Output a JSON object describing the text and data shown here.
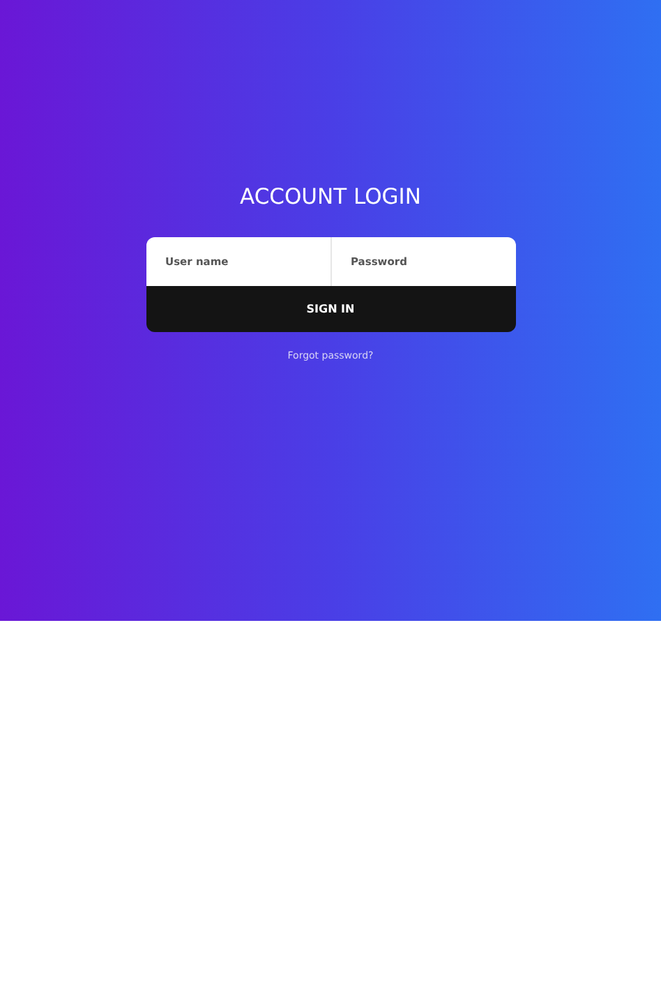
{
  "title": "ACCOUNT LOGIN",
  "fields": [
    {
      "placeholder": "User name"
    },
    {
      "placeholder": "Password"
    }
  ],
  "submit": "SIGN IN",
  "forgot_link": "Forgot password?"
}
